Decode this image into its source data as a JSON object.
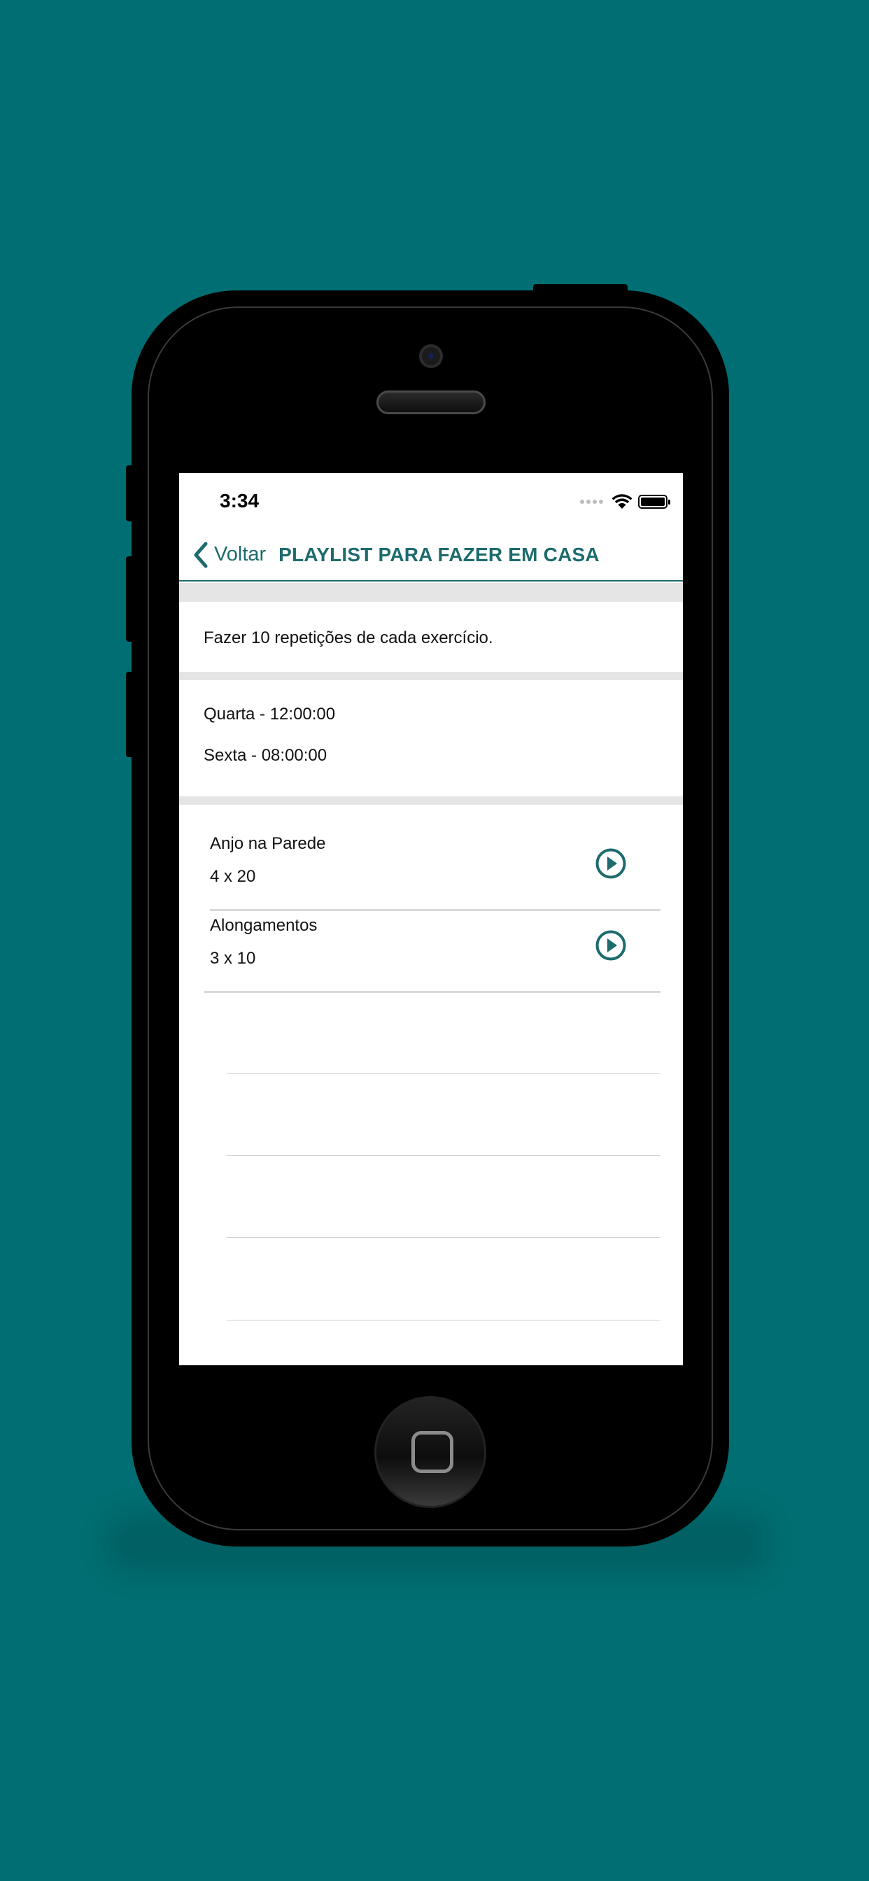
{
  "status_bar": {
    "time": "3:34"
  },
  "nav": {
    "back_label": "Voltar",
    "title": "PLAYLIST PARA FAZER EM CASA"
  },
  "instructions": "Fazer 10 repetições de cada exercício.",
  "schedule": [
    "Quarta - 12:00:00",
    "Sexta - 08:00:00"
  ],
  "exercises": [
    {
      "name": "Anjo na Parede",
      "reps": "4 x 20",
      "action_icon": "play-circle-icon"
    },
    {
      "name": "Alongamentos",
      "reps": "3 x 10",
      "action_icon": "play-circle-icon"
    }
  ],
  "colors": {
    "background": "#006e72",
    "accent": "#1d6b6d",
    "separator": "#e5e5e5"
  }
}
